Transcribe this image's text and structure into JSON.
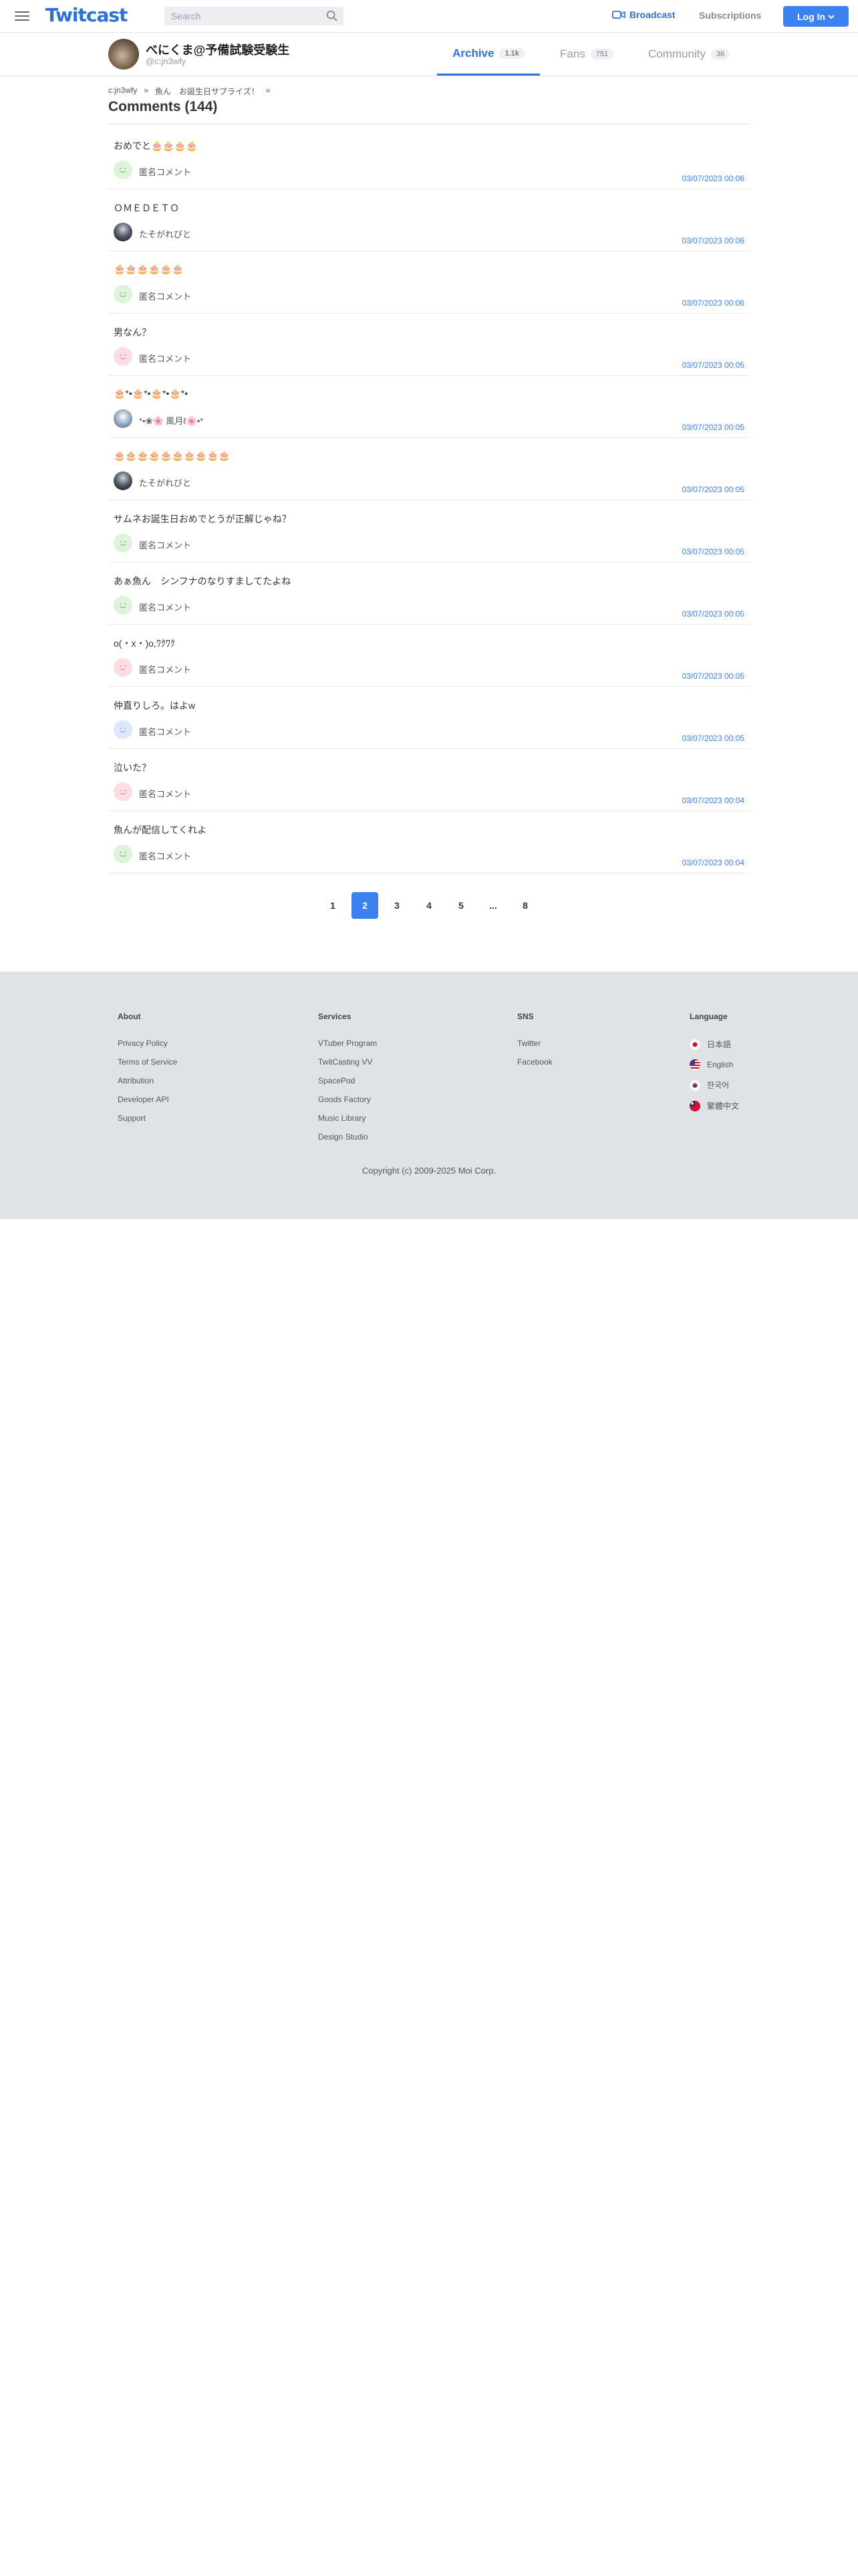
{
  "header": {
    "logo": "Twitcast",
    "search_placeholder": "Search",
    "broadcast": "Broadcast",
    "subscriptions": "Subscriptions",
    "login": "Log In"
  },
  "profile": {
    "name": "べにくま@予備試験受験生",
    "id": "@c:jn3wfy",
    "tabs": [
      {
        "label": "Archive",
        "count": "1.1k"
      },
      {
        "label": "Fans",
        "count": "751"
      },
      {
        "label": "Community",
        "count": "36"
      }
    ]
  },
  "breadcrumb": {
    "items": [
      "c:jn3wfy",
      "魚ん　お誕生日サプライズ！"
    ],
    "sep": "»"
  },
  "page_title": "Comments (144)",
  "comments": [
    {
      "text": "おめでと🎂🎂🎂🎂",
      "user": "匿名コメント",
      "time": "03/07/2023 00:06"
    },
    {
      "text": "ＯＭＥＤＥＴＯ",
      "user": "たそがれびと",
      "time": "03/07/2023 00:06"
    },
    {
      "text": "🎂🎂🎂🎂🎂🎂",
      "user": "匿名コメント",
      "time": "03/07/2023 00:06"
    },
    {
      "text": "男なん？",
      "user": "匿名コメント",
      "time": "03/07/2023 00:05"
    },
    {
      "text": "🎂*•🎂*•🎂*•🎂*•",
      "user": "*•❀🌸 風月ℓ🌸•*",
      "time": "03/07/2023 00:05"
    },
    {
      "text": "🎂🎂🎂🎂🎂🎂🎂🎂🎂🎂",
      "user": "たそがれびと",
      "time": "03/07/2023 00:05"
    },
    {
      "text": "サムネお誕生日おめでとうが正解じゃね？",
      "user": "匿名コメント",
      "time": "03/07/2023 00:05"
    },
    {
      "text": "あぁ魚ん　シンフナのなりすましてたよね",
      "user": "匿名コメント",
      "time": "03/07/2023 00:05"
    },
    {
      "text": "o(・x・)o,ﾜｸﾜｸ",
      "user": "匿名コメント",
      "time": "03/07/2023 00:05"
    },
    {
      "text": "仲直りしろ。はよw",
      "user": "匿名コメント",
      "time": "03/07/2023 00:05"
    },
    {
      "text": "泣いた？",
      "user": "匿名コメント",
      "time": "03/07/2023 00:04"
    },
    {
      "text": "魚んが配信してくれよ",
      "user": "匿名コメント",
      "time": "03/07/2023 00:04"
    }
  ],
  "pagination": [
    "1",
    "2",
    "3",
    "4",
    "5",
    "...",
    "8"
  ],
  "footer": {
    "about": {
      "title": "About",
      "links": [
        "Privacy Policy",
        "Terms of Service",
        "Attribution",
        "Developer API",
        "Support"
      ]
    },
    "services": {
      "title": "Services",
      "links": [
        "VTuber Program",
        "TwitCasting VV",
        "SpacePod",
        "Goods Factory",
        "Music Library",
        "Design Studio"
      ]
    },
    "sns": {
      "title": "SNS",
      "links": [
        "Twitter",
        "Facebook"
      ]
    },
    "language": {
      "title": "Language",
      "links": [
        "日本語",
        "English",
        "한국어",
        "繁體中文"
      ]
    },
    "copyright": "Copyright (c) 2009-2025 Moi Corp."
  },
  "colors": {
    "accent": "#3b82f0",
    "brand": "#2d72d9",
    "footer_bg": "#e0e3e6"
  }
}
